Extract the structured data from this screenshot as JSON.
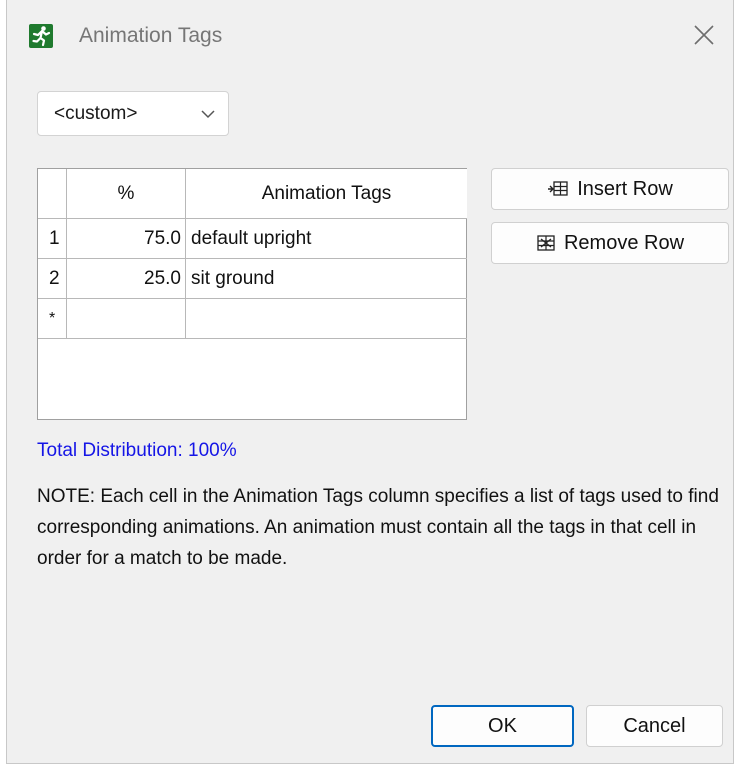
{
  "window": {
    "title": "Animation Tags",
    "icon": "running-figure-icon",
    "close_icon": "close-icon"
  },
  "preset": {
    "selected": "<custom>"
  },
  "table": {
    "columns": [
      "%",
      "Animation Tags"
    ],
    "rows": [
      {
        "index": "1",
        "percent": "75.0",
        "tags": "default upright"
      },
      {
        "index": "2",
        "percent": "25.0",
        "tags": "sit ground"
      },
      {
        "index": "*",
        "percent": "",
        "tags": ""
      }
    ]
  },
  "buttons": {
    "insert_row": "Insert Row",
    "remove_row": "Remove Row",
    "ok": "OK",
    "cancel": "Cancel"
  },
  "total_distribution": "Total Distribution: 100%",
  "note": "NOTE: Each cell in the Animation Tags column specifies a list of tags used to find corresponding animations. An animation must contain all the tags in that cell in order for a match to be made.",
  "colors": {
    "accent": "#0067c0",
    "total_text": "#1515e6",
    "icon_bg": "#1f7a2e"
  }
}
